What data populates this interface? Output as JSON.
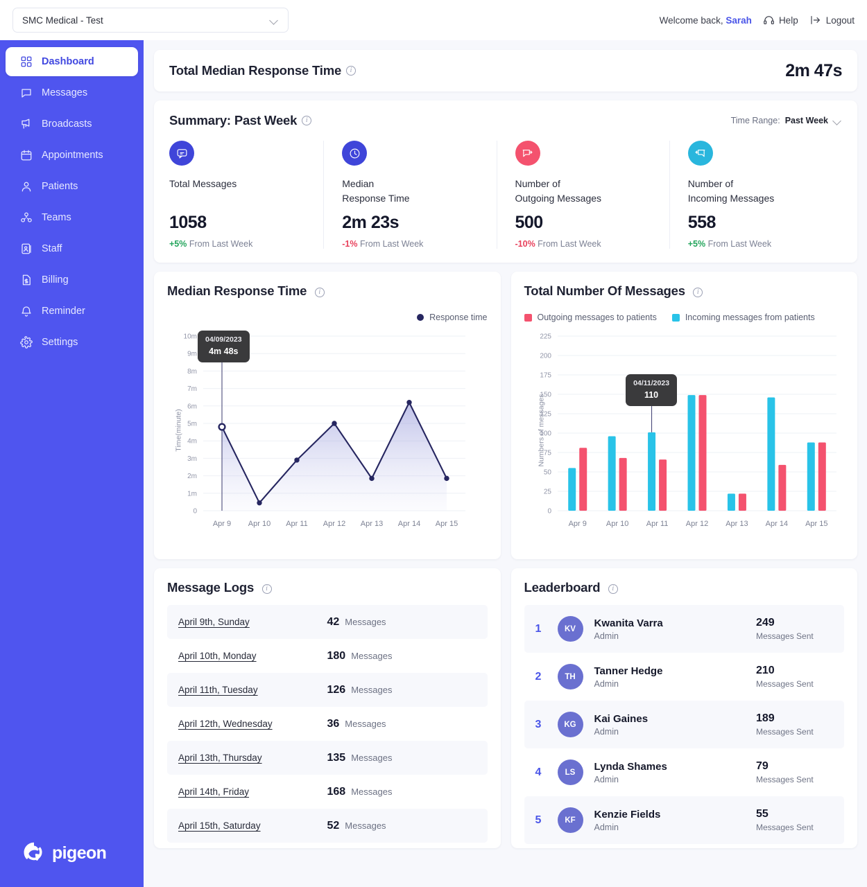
{
  "topbar": {
    "org_name": "SMC Medical - Test",
    "welcome_prefix": "Welcome back,",
    "user_name": "Sarah",
    "help_label": "Help",
    "logout_label": "Logout"
  },
  "sidebar": {
    "items": [
      {
        "label": "Dashboard",
        "icon": "grid-icon",
        "active": true
      },
      {
        "label": "Messages",
        "icon": "chat-icon",
        "active": false
      },
      {
        "label": "Broadcasts",
        "icon": "megaphone-icon",
        "active": false
      },
      {
        "label": "Appointments",
        "icon": "calendar-icon",
        "active": false
      },
      {
        "label": "Patients",
        "icon": "user-icon",
        "active": false
      },
      {
        "label": "Teams",
        "icon": "teams-icon",
        "active": false
      },
      {
        "label": "Staff",
        "icon": "id-card-icon",
        "active": false
      },
      {
        "label": "Billing",
        "icon": "invoice-icon",
        "active": false
      },
      {
        "label": "Reminder",
        "icon": "bell-icon",
        "active": false
      },
      {
        "label": "Settings",
        "icon": "gear-icon",
        "active": false
      }
    ],
    "logo_text": "pigeon"
  },
  "total_median": {
    "title": "Total Median Response Time",
    "value": "2m 47s"
  },
  "summary": {
    "title": "Summary: Past Week",
    "time_range_label": "Time Range:",
    "time_range_value": "Past Week",
    "cards": [
      {
        "label": "Total Messages",
        "value": "1058",
        "delta": "+5%",
        "delta_dir": "up",
        "delta_text": "From Last Week",
        "icon": "chat-bubble-icon",
        "color": "#3f45d9"
      },
      {
        "label": "Median\nResponse Time",
        "value": "2m 23s",
        "delta": "-1%",
        "delta_dir": "down",
        "delta_text": "From Last Week",
        "icon": "clock-icon",
        "color": "#3f45d9"
      },
      {
        "label": "Number of\nOutgoing Messages",
        "value": "500",
        "delta": "-10%",
        "delta_dir": "down",
        "delta_text": "From Last Week",
        "icon": "outgoing-message-icon",
        "color": "#f4526e"
      },
      {
        "label": "Number of\nIncoming Messages",
        "value": "558",
        "delta": "+5%",
        "delta_dir": "up",
        "delta_text": "From Last Week",
        "icon": "incoming-message-icon",
        "color": "#29b6dd"
      }
    ]
  },
  "message_logs": {
    "title": "Message Logs",
    "unit": "Messages",
    "rows": [
      {
        "date": "April 9th, Sunday",
        "count": "42"
      },
      {
        "date": "April 10th, Monday",
        "count": "180"
      },
      {
        "date": "April 11th, Tuesday",
        "count": "126"
      },
      {
        "date": "April 12th, Wednesday",
        "count": "36"
      },
      {
        "date": "April 13th, Thursday",
        "count": "135"
      },
      {
        "date": "April 14th, Friday",
        "count": "168"
      },
      {
        "date": "April 15th, Saturday",
        "count": "52"
      }
    ]
  },
  "leaderboard": {
    "title": "Leaderboard",
    "unit": "Messages Sent",
    "rows": [
      {
        "rank": "1",
        "initials": "KV",
        "name": "Kwanita Varra",
        "role": "Admin",
        "count": "249"
      },
      {
        "rank": "2",
        "initials": "TH",
        "name": "Tanner Hedge",
        "role": "Admin",
        "count": "210"
      },
      {
        "rank": "3",
        "initials": "KG",
        "name": "Kai Gaines",
        "role": "Admin",
        "count": "189"
      },
      {
        "rank": "4",
        "initials": "LS",
        "name": "Lynda Shames",
        "role": "Admin",
        "count": "79"
      },
      {
        "rank": "5",
        "initials": "KF",
        "name": "Kenzie Fields",
        "role": "Admin",
        "count": "55"
      }
    ]
  },
  "chart_data": [
    {
      "type": "area",
      "id": "median-response-time",
      "title": "Median Response Time",
      "xlabel": "",
      "ylabel": "Time(minute)",
      "categories": [
        "Apr 9",
        "Apr 10",
        "Apr 11",
        "Apr 12",
        "Apr 13",
        "Apr 14",
        "Apr 15"
      ],
      "ytick_labels": [
        "0",
        "1m",
        "2m",
        "3m",
        "4m",
        "5m",
        "6m",
        "7m",
        "8m",
        "9m",
        "10m"
      ],
      "ylim": [
        0,
        10
      ],
      "grid": true,
      "legend": {
        "position": "top-right",
        "entries": [
          "Response time"
        ]
      },
      "series": [
        {
          "name": "Response time",
          "color": "#262660",
          "values": [
            4.8,
            0.45,
            2.9,
            5.0,
            1.85,
            6.2,
            1.85
          ]
        }
      ],
      "tooltip": {
        "date": "04/09/2023",
        "value": "4m 48s",
        "at_category": "Apr 9"
      }
    },
    {
      "type": "bar",
      "id": "total-number-of-messages",
      "title": "Total Number Of Messages",
      "xlabel": "",
      "ylabel": "Numbers of messages",
      "categories": [
        "Apr 9",
        "Apr 10",
        "Apr 11",
        "Apr 12",
        "Apr 13",
        "Apr 14",
        "Apr 15"
      ],
      "ytick_labels": [
        "0",
        "25",
        "50",
        "75",
        "100",
        "125",
        "150",
        "175",
        "200",
        "225"
      ],
      "ylim": [
        0,
        225
      ],
      "grid": true,
      "legend": {
        "position": "top-left",
        "entries": [
          "Outgoing messages to patients",
          "Incoming messages from patients"
        ]
      },
      "series": [
        {
          "name": "Incoming messages from patients",
          "color": "#29c3e8",
          "values": [
            55,
            96,
            101,
            149,
            22,
            146,
            88
          ]
        },
        {
          "name": "Outgoing messages to patients",
          "color": "#f4526e",
          "values": [
            81,
            68,
            66,
            149,
            22,
            59,
            88
          ]
        }
      ],
      "tooltip": {
        "date": "04/11/2023",
        "value": "110",
        "at_category": "Apr 11"
      }
    }
  ]
}
